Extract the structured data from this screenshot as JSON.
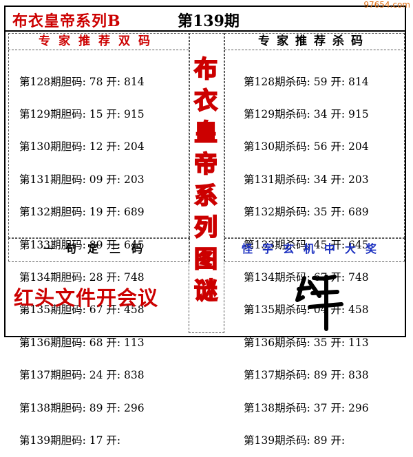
{
  "watermark": "97654.com",
  "title": "布衣皇帝系列B",
  "issue": "第139期",
  "left_header": "专家推荐双码",
  "right_header": "专家推荐杀码",
  "left_rows": [
    "第128期胆码: 78 开: 814",
    "第129期胆码: 15 开: 915",
    "第130期胆码: 12 开: 204",
    "第131期胆码: 09 开: 203",
    "第132期胆码: 19 开: 689",
    "第133期胆码: 89 开: 645",
    "第134期胆码: 28 开: 748",
    "第135期胆码: 67 开: 458",
    "第136期胆码: 68 开: 113",
    "第137期胆码: 24 开: 838",
    "第138期胆码: 89 开: 296",
    "第139期胆码: 17 开:"
  ],
  "right_rows": [
    "第128期杀码: 59 开: 814",
    "第129期杀码: 34 开: 915",
    "第130期杀码: 56 开: 204",
    "第131期杀码: 34 开: 203",
    "第132期杀码: 35 开: 689",
    "第133期杀码: 45 开: 645",
    "第134期杀码: 67 开: 748",
    "第135期杀码: 04 开: 458",
    "第136期杀码: 35 开: 113",
    "第137期杀码: 89 开: 838",
    "第138期杀码: 37 开: 296",
    "第139期杀码: 89 开:"
  ],
  "vertical_title": [
    "布",
    "衣",
    "皇",
    "帝",
    "系",
    "列",
    "图",
    "谜"
  ],
  "slogan_left": "一句定三码",
  "clue_text": "红头文件开会议",
  "slogan_right": "怪字玄机中大奖",
  "colors": {
    "red": "#cc0000",
    "blue": "#1a2fc0",
    "orange": "#e06d10"
  }
}
